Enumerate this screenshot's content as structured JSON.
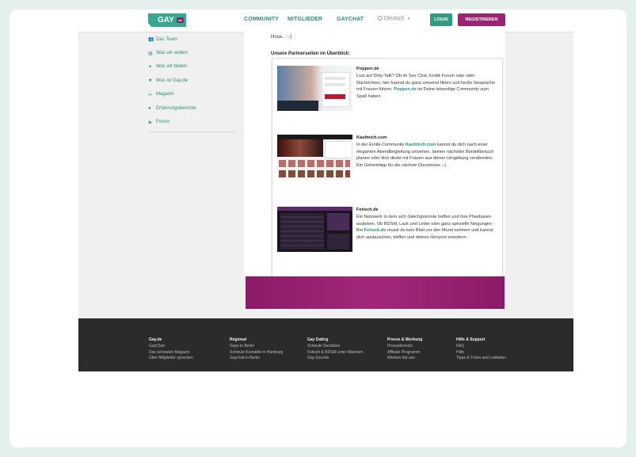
{
  "header": {
    "logo_text": "GAY",
    "logo_badge": "de",
    "nav": [
      "COMMUNITY",
      "MITGLIEDER",
      "GAYCHAT"
    ],
    "language": "Deutsch",
    "login_label": "LOGIN",
    "register_label": "REGISTRIEREN"
  },
  "sidebar": {
    "items": [
      {
        "label": "Das Team",
        "icon": "team-icon"
      },
      {
        "label": "Was wir wollen",
        "icon": "list-icon"
      },
      {
        "label": "Was wir bieten",
        "icon": "tag-icon"
      },
      {
        "label": "Was ist Gay.de",
        "icon": "star-icon"
      },
      {
        "label": "Magazin",
        "icon": "rss-icon"
      },
      {
        "label": "Erfahrungsberichte",
        "icon": "chat-icon"
      },
      {
        "label": "Forum",
        "icon": "forum-icon"
      }
    ]
  },
  "content": {
    "intro": "Hose... ;-)",
    "subheading": "Unsere Partnerseiten im Überblick:",
    "partners": [
      {
        "title": "Poppen.de",
        "text_before": "Lust auf Dirty-Talk? Ob im Sex Chat, Erotik Forum oder über Nachrichten, hier kannst du ganz umsonst flirten und heiße Gespräche mit Frauen führen. ",
        "link": "Poppen.de",
        "text_after": " ist Deine lebendige Community zum Spaß haben."
      },
      {
        "title": "Kaufmich.com",
        "text_before": "In der Erotik-Community ",
        "link": "Kaufmich.com",
        "text_after": " kannst du dich nach einer eleganten Abendbegleitung umsehen, deinen nächsten Bordellbesuch planen oder dich direkt mit Frauen aus deiner Umgebung verabreden. Ein Geheimtipp für die nächste Dienstreise ;-)."
      },
      {
        "title": "Fetisch.de",
        "text_before": "Ein Netzwerk in dem sich Gleichgesinnte treffen und ihre Phantasien ausleben. Ob BDSM, Lack und Leder oder ganz spezielle Neigungen - Bei ",
        "link": "Fetisch.de",
        "text_after": " musst du kein Blatt vor den Mund nehmen und kannst dich austauschen, treffen und deinen Horizont erweitern."
      }
    ]
  },
  "footer": {
    "columns": [
      {
        "heading": "Gay.de",
        "links": [
          "GayChat",
          "Das schwulen Magazin",
          "Über Mitglieder sprechen"
        ]
      },
      {
        "heading": "Regional",
        "links": [
          "Gays in Berlin",
          "Schwule Kontakte in Hamburg",
          "Gaychat in Berlin"
        ]
      },
      {
        "heading": "Gay Dating",
        "links": [
          "Schwule Sexdates",
          "Fetisch & BDSM unter Männern",
          "Gay Escorts"
        ]
      },
      {
        "heading": "Presse & Werbung",
        "links": [
          "Pressebereich",
          "Affiliate Programm",
          "Werben bei uns"
        ]
      },
      {
        "heading": "Hilfe & Support",
        "links": [
          "FAQ",
          "Hilfe",
          "Tipps & Tricks und Leitfaden"
        ]
      }
    ]
  },
  "colors": {
    "brand_green": "#36a88f",
    "brand_purple": "#9a2374",
    "footer_bg": "#2b2b2b"
  }
}
